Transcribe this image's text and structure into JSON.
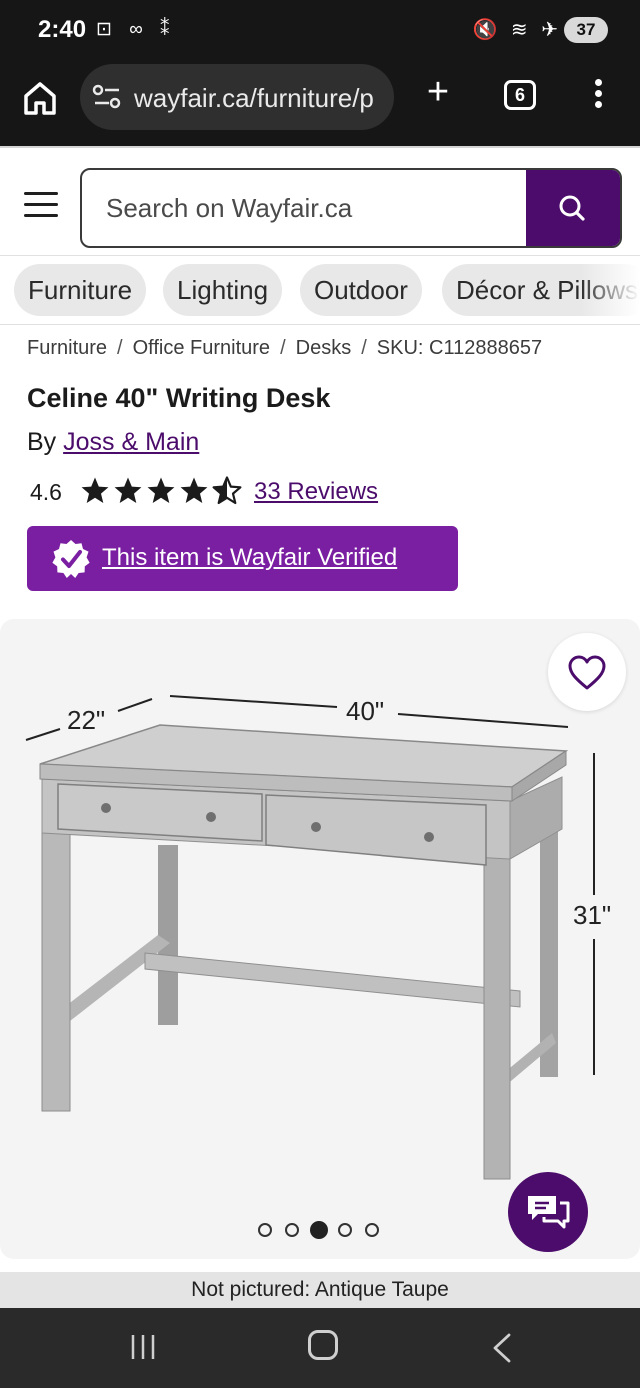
{
  "status_bar": {
    "time": "2:40",
    "left_icons": "⊡ ∞ ⁑",
    "right_icons": "🔇 ≋ ✈",
    "battery": "37"
  },
  "browser": {
    "url": "wayfair.ca/furniture/p",
    "tab_count": "6"
  },
  "header": {
    "search_placeholder": "Search on Wayfair.ca"
  },
  "categories": [
    "Furniture",
    "Lighting",
    "Outdoor",
    "Décor & Pillows"
  ],
  "breadcrumb": {
    "items": [
      "Furniture",
      "Office Furniture",
      "Desks"
    ],
    "separator": "/",
    "sku": "SKU: C112888657"
  },
  "product": {
    "title": "Celine 40\" Writing Desk",
    "by_label": "By ",
    "brand": "Joss & Main",
    "rating": "4.6",
    "rating_value": 4.6,
    "reviews": "33 Reviews",
    "verified_text": "This item is Wayfair Verified"
  },
  "image": {
    "dim_depth": "22\"",
    "dim_width": "40\"",
    "dim_height": "31\"",
    "dot_count": 5,
    "active_dot": 3
  },
  "not_pictured": "Not pictured: Antique Taupe",
  "colors": {
    "brand_purple": "#4b0c6b",
    "verified_purple": "#7b1fa2",
    "chip_bg": "#e8e8e8"
  }
}
